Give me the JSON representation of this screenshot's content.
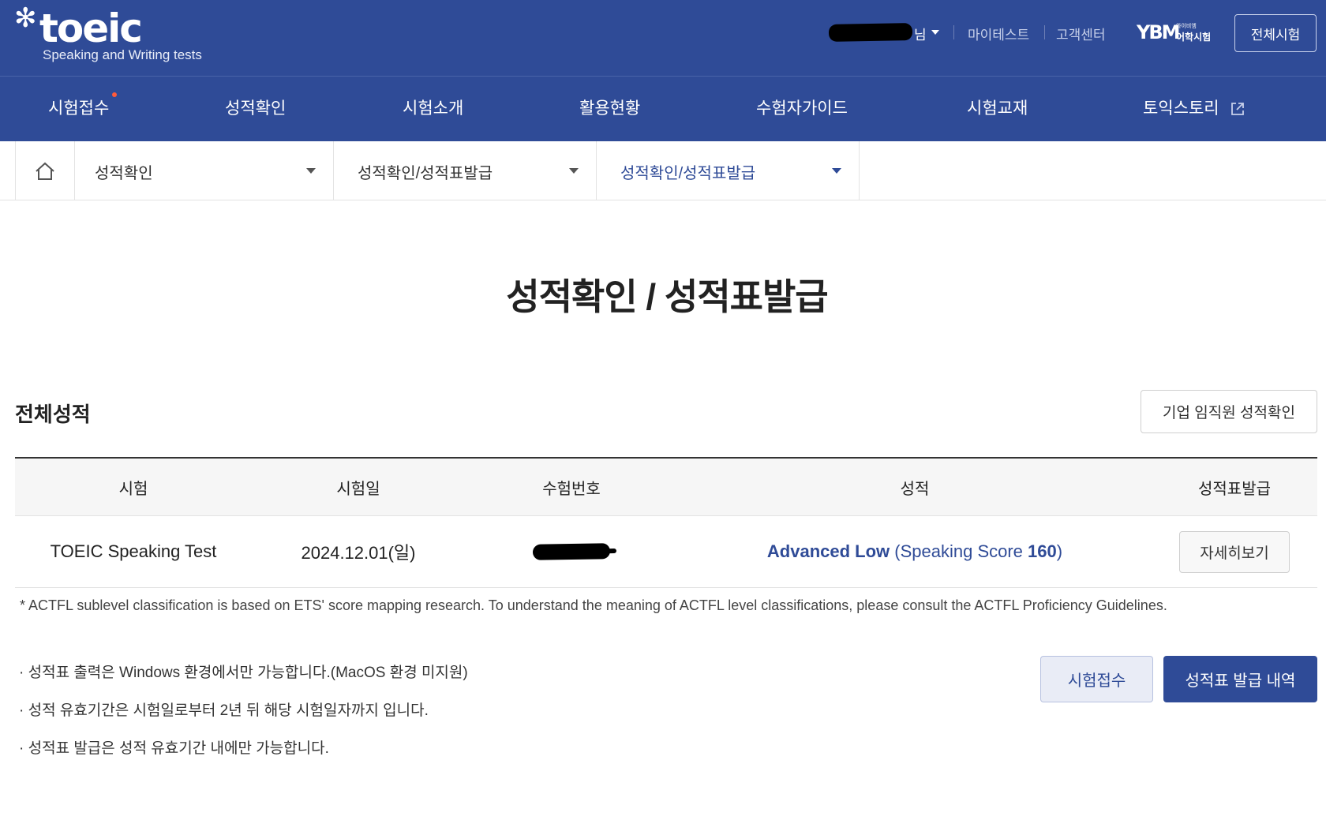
{
  "header": {
    "logo": {
      "wordmark": "toeic",
      "tagline": "Speaking and Writing tests"
    },
    "user": {
      "name_suffix": "님"
    },
    "util_links": [
      "마이테스트",
      "고객센터"
    ],
    "ybm_logo": {
      "mark": "YBM",
      "line1": "와이비엠",
      "line2": "어학시험"
    },
    "all_exams_button": "전체시험"
  },
  "nav": {
    "items": [
      "시험접수",
      "성적확인",
      "시험소개",
      "활용현황",
      "수험자가이드",
      "시험교재",
      "토익스토리"
    ]
  },
  "breadcrumb": {
    "levels": [
      "성적확인",
      "성적확인/성적표발급",
      "성적확인/성적표발급"
    ]
  },
  "page": {
    "title": "성적확인 / 성적표발급",
    "section_title": "전체성적",
    "corp_button": "기업 임직원 성적확인"
  },
  "table": {
    "headers": [
      "시험",
      "시험일",
      "수험번호",
      "성적",
      "성적표발급"
    ],
    "rows": [
      {
        "exam": "TOEIC Speaking Test",
        "date": "2024.12.01(일)",
        "score_level": "Advanced Low",
        "score_detail_prefix": " (Speaking Score ",
        "score_value": "160",
        "score_detail_suffix": ")",
        "detail_button": "자세히보기"
      }
    ]
  },
  "footnote": "* ACTFL sublevel classification is based on ETS' score mapping research. To understand the meaning of ACTFL level classifications, please consult the ACTFL Proficiency Guidelines.",
  "notices": [
    "· 성적표 출력은 Windows 환경에서만 가능합니다.(MacOS 환경 미지원)",
    "· 성적 유효기간은 시험일로부터 2년 뒤 해당 시험일자까지 입니다.",
    "· 성적표 발급은 성적 유효기간 내에만 가능합니다."
  ],
  "actions": {
    "apply_button": "시험접수",
    "history_button": "성적표 발급 내역"
  },
  "colors": {
    "brand_navy": "#2f4b97",
    "notification_dot": "#ff5a3a"
  }
}
